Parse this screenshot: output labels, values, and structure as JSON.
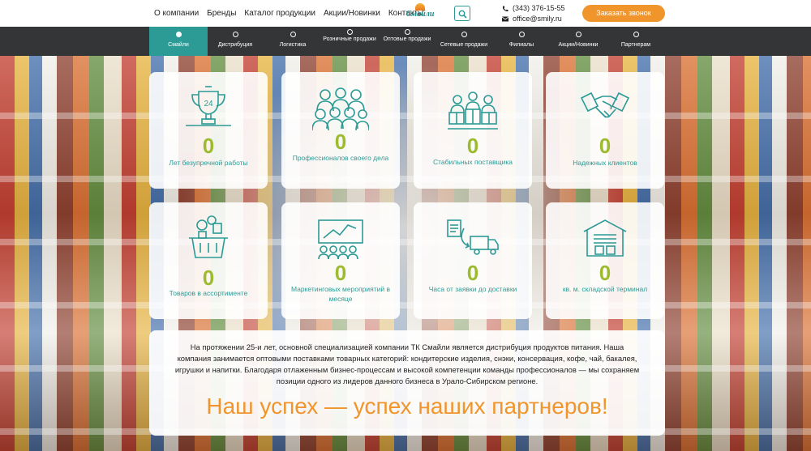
{
  "header": {
    "menu": [
      "О компании",
      "Бренды",
      "Каталог продукции",
      "Акции/Новинки",
      "Контакты"
    ],
    "logo_text": "Смайли",
    "phone": "(343) 376-15-55",
    "email": "office@smily.ru",
    "call_button": "Заказать звонок",
    "icons": {
      "search": "search-icon",
      "phone": "phone-icon",
      "email": "envelope-icon"
    }
  },
  "tabs": [
    {
      "label": "Смайли",
      "active": true
    },
    {
      "label": "Дистрибуция"
    },
    {
      "label": "Логистика"
    },
    {
      "label": "Розничные продажи"
    },
    {
      "label": "Оптовые продажи"
    },
    {
      "label": "Сетевые продажи"
    },
    {
      "label": "Филиалы"
    },
    {
      "label": "Акции/Новинки"
    },
    {
      "label": "Партнерам"
    }
  ],
  "stats": [
    {
      "value": "0",
      "caption": "Лет безупречной работы",
      "icon": "trophy-icon"
    },
    {
      "value": "0",
      "caption": "Профессионалов своего дела",
      "icon": "team-icon"
    },
    {
      "value": "0",
      "caption": "Стабильных поставщика",
      "icon": "suppliers-icon"
    },
    {
      "value": "0",
      "caption": "Надежных клиентов",
      "icon": "handshake-icon"
    },
    {
      "value": "0",
      "caption": "Товаров в ассортименте",
      "icon": "basket-icon"
    },
    {
      "value": "0",
      "caption": "Маркетинговых мероприятий в месяце",
      "icon": "presentation-icon"
    },
    {
      "value": "0",
      "caption": "Часа от заявки до доставки",
      "icon": "delivery-truck-icon"
    },
    {
      "value": "0",
      "caption": "кв. м. складской терминал",
      "icon": "warehouse-icon"
    }
  ],
  "about": {
    "text": "На протяжении 25-и лет, основной специализацией компании ТК Смайли является дистрибуция продуктов питания. Наша компания занимается оптовыми поставками товарных категорий: кондитерские изделия, снэки, консервация, кофе, чай, бакалея, игрушки и напитки. Благодаря отлаженным бизнес-процессам и высокой компетенции команды профессионалов — мы сохраняем позиции одного из лидеров данного бизнеса в Урало-Сибирском регионе.",
    "slogan": "Наш успех — успех наших партнеров!"
  },
  "colors": {
    "accent": "#2c9a95",
    "orange": "#f0952b",
    "number_green": "#9dbb2e",
    "tabs_bg": "#333537"
  }
}
